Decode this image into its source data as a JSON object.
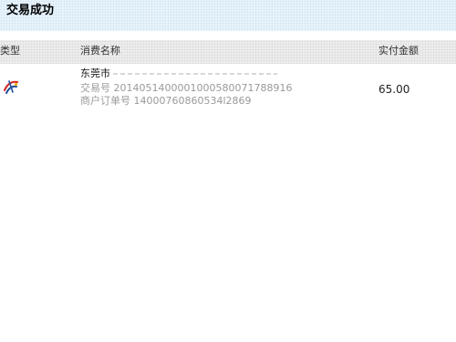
{
  "header": {
    "title": "交易成功"
  },
  "table": {
    "columns": {
      "type": "类型",
      "name": "消费名称",
      "amount": "实付金额"
    },
    "rows": [
      {
        "type_icon": "unionpay-style-icon",
        "merchant": "东莞市",
        "trade_no_label": "交易号",
        "trade_no": "20140514000010005800717 88916",
        "trade_no_text": "交易号 2014051400001000580071788916",
        "order_no_text": "商户订单号 14000760860534l2869",
        "amount": "65.00"
      }
    ]
  },
  "colors": {
    "header_bg": "#eaf4fb",
    "table_head_bg": "#eeeeee",
    "muted_text": "#9a9a9a",
    "icon_red": "#d32f2f",
    "icon_blue": "#1f4e9c",
    "icon_yellow": "#f0b400"
  }
}
